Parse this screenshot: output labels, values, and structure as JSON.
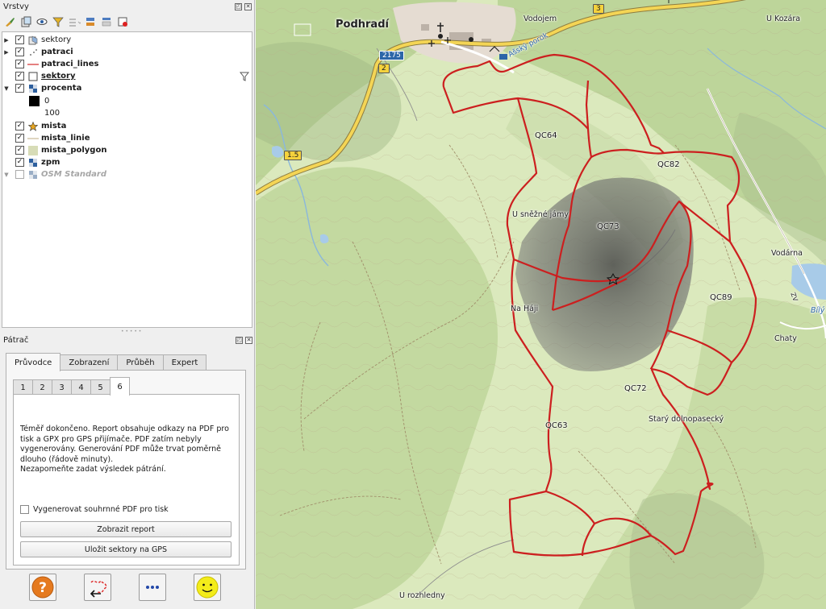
{
  "layers_panel": {
    "title": "Vrstvy",
    "float_icon": "float-icon",
    "close_icon": "close-icon",
    "toolbar_icons": [
      "style-brush-icon",
      "add-group-icon",
      "visibility-eye-icon",
      "filter-icon",
      "group-layers-icon",
      "expand-all-icon",
      "collapse-all-icon",
      "remove-layer-icon"
    ],
    "layers": [
      {
        "name": "sektory",
        "checked": true,
        "expander": "right",
        "icon": "wms-icon",
        "style": "normal"
      },
      {
        "name": "patraci",
        "checked": true,
        "expander": "right",
        "icon": "points-icon",
        "style": "bold"
      },
      {
        "name": "patraci_lines",
        "checked": true,
        "expander": "none",
        "icon": "red-line-icon",
        "style": "bold"
      },
      {
        "name": "sektory",
        "checked": true,
        "expander": "none",
        "icon": "empty-polygon-icon",
        "style": "bold-underline"
      },
      {
        "name": "procenta",
        "checked": true,
        "expander": "down",
        "icon": "raster-icon",
        "style": "bold"
      },
      {
        "name": "0",
        "checked": null,
        "expander": "none",
        "icon": "black-square-icon",
        "style": "normal"
      },
      {
        "name": "100",
        "checked": null,
        "expander": "none",
        "icon": "white-square-icon",
        "style": "normal"
      },
      {
        "name": "mista",
        "checked": true,
        "expander": "none",
        "icon": "star-icon",
        "style": "bold"
      },
      {
        "name": "mista_linie",
        "checked": true,
        "expander": "none",
        "icon": "line-icon",
        "style": "bold"
      },
      {
        "name": "mista_polygon",
        "checked": true,
        "expander": "none",
        "icon": "polygon-icon",
        "style": "bold"
      },
      {
        "name": "zpm",
        "checked": true,
        "expander": "none",
        "icon": "raster-icon",
        "style": "bold"
      },
      {
        "name": "OSM Standard",
        "checked": false,
        "expander": "down",
        "icon": "raster-icon",
        "style": "italic-grey"
      }
    ]
  },
  "patrac_panel": {
    "title": "Pátrač",
    "tabs": [
      {
        "label": "Průvodce",
        "active": true
      },
      {
        "label": "Zobrazení",
        "active": false
      },
      {
        "label": "Průběh",
        "active": false
      },
      {
        "label": "Expert",
        "active": false
      }
    ],
    "step_tabs": [
      {
        "label": "1",
        "active": false
      },
      {
        "label": "2",
        "active": false
      },
      {
        "label": "3",
        "active": false
      },
      {
        "label": "4",
        "active": false
      },
      {
        "label": "5",
        "active": false
      },
      {
        "label": "6",
        "active": true
      }
    ],
    "info_line1": "Téměř dokončeno. Report obsahuje odkazy na PDF pro tisk a GPX pro GPS přijímače. PDF zatím nebyly vygenerovány. Generování PDF může trvat poměrně dlouho (řádově minuty).",
    "info_line2": "Nezapomeňte zadat výsledek pátrání.",
    "pdf_checkbox_label": "Vygenerovat souhrnné PDF pro tisk",
    "pdf_checked": false,
    "show_report_button": "Zobrazit report",
    "save_gps_button": "Uložit sektory na GPS",
    "bottom_buttons": [
      "help-icon",
      "back-to-map-icon",
      "more-icon",
      "smiley-icon"
    ]
  },
  "map": {
    "town_label": "Podhradí",
    "labels": {
      "vodojem": "Vodojem",
      "u_kozara": "U Kozára",
      "azsky_porok": "Ašský porok",
      "u_snezne_jamy": "U sněžné jámy",
      "na_haji": "Na Háji",
      "vodarna": "Vodárna",
      "chaty": "Chaty",
      "bily": "Bílý",
      "stary_dolnopasecky": "Starý dolnopasecký",
      "u_rozhledny": "U rozhledny",
      "zv": "ZV"
    },
    "road_signs": {
      "r2175": "2175",
      "r2": "2",
      "r3": "3",
      "r15": "1.5"
    },
    "sectors": [
      "QC64",
      "QC82",
      "QC73",
      "QC89",
      "QC72",
      "QC63"
    ],
    "colors": {
      "sector_line": "#cc1f1f",
      "probability": "#585858",
      "forest": "#bfd69a",
      "meadow": "#e4efc6",
      "water": "#a8cbe8"
    }
  }
}
